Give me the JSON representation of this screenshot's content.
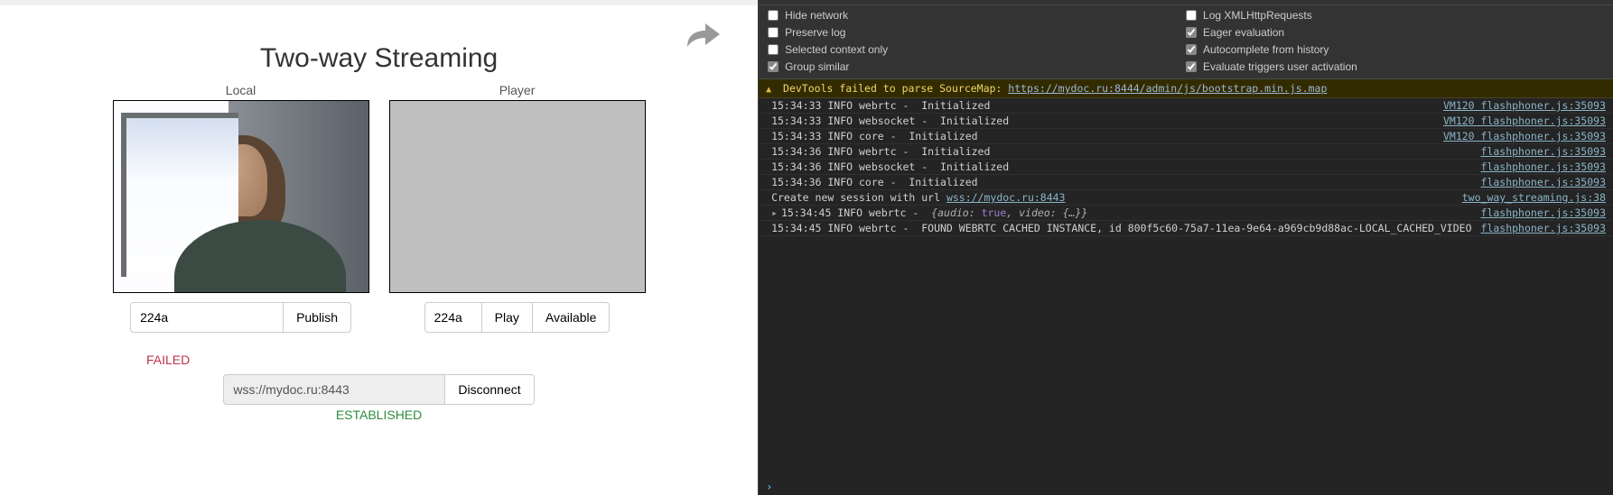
{
  "page": {
    "title": "Two-way Streaming"
  },
  "local": {
    "label": "Local",
    "stream_name": "224a",
    "publish_button": "Publish",
    "status": "FAILED"
  },
  "player": {
    "label": "Player",
    "stream_name": "224a",
    "play_button": "Play",
    "available_button": "Available"
  },
  "connection": {
    "url": "wss://mydoc.ru:8443",
    "disconnect_button": "Disconnect",
    "status": "ESTABLISHED"
  },
  "devtools": {
    "settings": {
      "hide_network": {
        "label": "Hide network",
        "checked": false
      },
      "log_xhr": {
        "label": "Log XMLHttpRequests",
        "checked": false
      },
      "preserve_log": {
        "label": "Preserve log",
        "checked": false
      },
      "eager_eval": {
        "label": "Eager evaluation",
        "checked": true
      },
      "selected_context": {
        "label": "Selected context only",
        "checked": false
      },
      "autocomplete_history": {
        "label": "Autocomplete from history",
        "checked": true
      },
      "group_similar": {
        "label": "Group similar",
        "checked": true
      },
      "eval_user_activation": {
        "label": "Evaluate triggers user activation",
        "checked": true
      }
    },
    "warning": {
      "text": "DevTools failed to parse SourceMap: ",
      "url": "https://mydoc.ru:8444/admin/js/bootstrap.min.js.map"
    },
    "logs": [
      {
        "msg": "15:34:33 INFO webrtc -  Initialized",
        "src": "VM120 flashphoner.js:35093"
      },
      {
        "msg": "15:34:33 INFO websocket -  Initialized",
        "src": "VM120 flashphoner.js:35093"
      },
      {
        "msg": "15:34:33 INFO core -  Initialized",
        "src": "VM120 flashphoner.js:35093"
      },
      {
        "msg": "15:34:36 INFO webrtc -  Initialized",
        "src": "flashphoner.js:35093"
      },
      {
        "msg": "15:34:36 INFO websocket -  Initialized",
        "src": "flashphoner.js:35093"
      },
      {
        "msg": "15:34:36 INFO core -  Initialized",
        "src": "flashphoner.js:35093"
      },
      {
        "msg": "Create new session with url ",
        "url": "wss://mydoc.ru:8443",
        "src": "two_way_streaming.js:38"
      },
      {
        "msg": "15:34:45 INFO webrtc -  ",
        "obj": "{audio: true, video: {…}}",
        "expand": true,
        "src": "flashphoner.js:35093"
      },
      {
        "msg": "15:34:45 INFO webrtc -  FOUND WEBRTC CACHED INSTANCE, id 800f5c60-75a7-11ea-9e64-a969cb9d88ac-LOCAL_CACHED_VIDEO",
        "src": "flashphoner.js:35093"
      }
    ]
  }
}
